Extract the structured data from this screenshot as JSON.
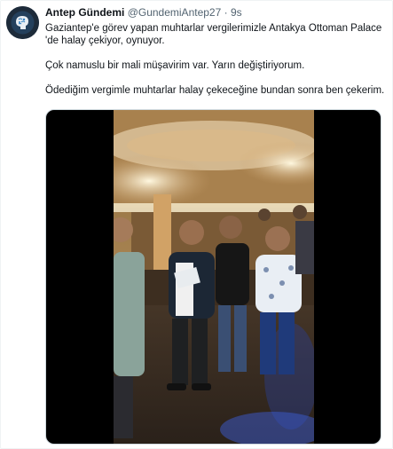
{
  "tweet": {
    "author_name": "Antep Gündemi",
    "author_handle": "@GundemiAntep27",
    "separator": "·",
    "time": "9s",
    "text_line1": "Gaziantep'e görev yapan muhtarlar vergilerimizle Antakya Ottoman Palace 'de halay çekiyor, oynuyor.",
    "text_line2": "Çok namuslu bir mali müşavirim var. Yarın değiştiriyorum.",
    "text_line3": "Ödediğim vergimle muhtarlar halay çekeceğine bundan sonra ben çekerim."
  },
  "icons": {
    "avatar": "brain-logo-avatar",
    "media": "video-frame"
  },
  "colors": {
    "text": "#0f1419",
    "secondary": "#536471",
    "media_bg": "#000000",
    "avatar_bg": "#1d2b3a"
  }
}
